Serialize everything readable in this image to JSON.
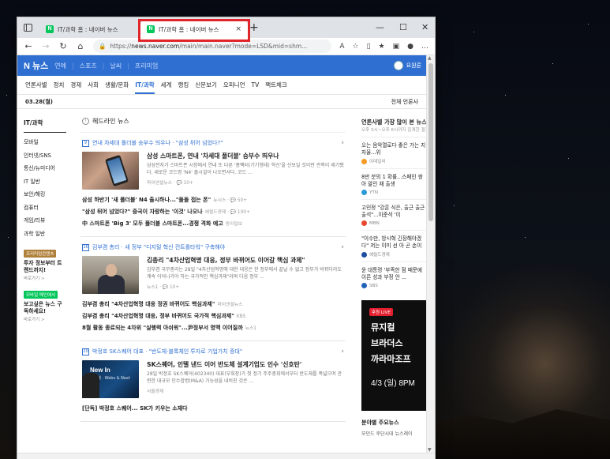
{
  "browser": {
    "tabs": [
      {
        "title": "IT/과학 홈 : 네이버 뉴스",
        "close": "×"
      },
      {
        "title": "IT/과학 홈 : 네이버 뉴스",
        "close": "×"
      }
    ],
    "new_tab": "+",
    "window_controls": [
      "—",
      "☐",
      "✕"
    ],
    "url_prefix": "https://",
    "url_host": "news.naver.com",
    "url_rest": "/main/main.naver?mode=LSD&mid=shm..."
  },
  "naver": {
    "logo_n": "N",
    "logo_text": "뉴스",
    "gnb": [
      "연예",
      "스포츠",
      "날씨",
      "프리미엄"
    ],
    "user": "요원론",
    "lnb": [
      "언론사별",
      "정치",
      "경제",
      "사회",
      "생활/문화",
      "IT/과학",
      "세계",
      "랭킹",
      "신문보기",
      "오피니언",
      "TV",
      "팩트체크"
    ],
    "active_lnb": "IT/과학",
    "date": "03.28(월)",
    "all_press": "전체 언론사"
  },
  "sidebar": {
    "title": "IT/과학",
    "items": [
      "모바일",
      "인터넷/SNS",
      "통신/뉴미디어",
      "IT 일반",
      "보안/해킹",
      "컴퓨터",
      "게임/리뷰",
      "과학 일반"
    ],
    "promo1": {
      "tag": "프리미엄콘텐츠",
      "title": "투자 정보부터 트렌드까지!",
      "sub": "바로가기 >"
    },
    "promo2": {
      "tag": "모바일 메인에서",
      "title": "보고싶은 뉴스 구독하세요!",
      "sub": "바로가기 >"
    }
  },
  "main": {
    "headline_title": "헤드라인 뉴스",
    "clusters": [
      {
        "num": "9",
        "head": "연내 차세대 폴더블 승부수 띄우나 · \"삼성 뒤어 넘었다?\"",
        "title": "삼성 스마트폰, 연내 '차세대 폴더블' 승부수 띄우나",
        "desc": "삼성전자가 스마트폰 시장에서 연내 또 다른 '폼팩터(기기형태) 혁신'을 선보일 것이란 관측이 제기됐다. 새로운 코드명 'N4' 출시설이 나오면서다. 코드 ...",
        "meta": "파이낸셜뉴스 · 💬 10+",
        "related": [
          {
            "text": "삼성 하반기 '새 폴더블' N4 출시하나...\"돌돌 접는 폰\"",
            "src": "뉴시스 · 💬 50+"
          },
          {
            "text": "\"삼성 뒤어 넘었다?\" 중국이 자랑하는 '이것' 나오나",
            "src": "헤럴드경제 · 💬 100+"
          },
          {
            "text": "中 스마트폰 'Big 3' 모두 폴더블 스마트폰...경쟁 격화 예고",
            "src": "동아일보"
          }
        ]
      },
      {
        "num": "16",
        "head": "김부겸 총리 · 새 정부 \"디지털 혁신 컨트롤타워\" 구축해야",
        "title": "김총리 \"4차산업혁명 대응, 정부 바뀌어도 이어갈 핵심 과제\"",
        "desc": "김부겸 국무총리는 28일 \"4차산업혁명에 대한 대응은 한 정부에서 끝날 수 없고 정부가 바뀌더라도 계속 이어나가야 하는 국가적인 핵심과제\"라며 다음 정부 ...",
        "meta": "뉴스1 · 💬 10+",
        "related": [
          {
            "text": "김부겸 총리 \"4차산업혁명 대응 정권 바뀌어도 핵심과제\"",
            "src": "파이낸셜뉴스"
          },
          {
            "text": "김부겸 총리 \"4차산업혁명 대응, 정부 바뀌어도 국가적 핵심과제\"",
            "src": "KBS"
          },
          {
            "text": "8월 활동 종료되는 4차위 \"실행력 아쉬워\"...尹정부서 명맥 이어질까",
            "src": "뉴스1"
          }
        ]
      },
      {
        "num": "20",
        "head": "박정호 SK스퀘어 대표 · \"반도체·블록체인 투자로 기업가치 증대\"",
        "title": "SK스퀘어, 인텔 낸드 이어 반도체 설계기업도 인수 '신호탄'",
        "desc": "28일 박정호 SK스퀘어(402340) 대표(부회장)가 첫 정기 주주총회에서부터 반도체를 폭넓으며 관련한 대규모 인수합병(M&A) 가능성을 내비친 것은 ...",
        "meta": "서울경제",
        "thumb_title": "New In",
        "thumb_sub": "반도체 · Webs\n& Next Platf",
        "related": [
          {
            "text": "[단독] 박정호 스퀘어... SK가 키우는 소재다",
            "src": ""
          }
        ]
      }
    ]
  },
  "rightpanel": {
    "title": "언론사별 가장 많이 본 뉴스",
    "sub": "오후 5시~오후 6시까지 집계한 결과입니다.",
    "items": [
      {
        "text": "오는 음악열로다 좋은 가는 지자율...위",
        "src": "이데일리",
        "color": "#f39b23"
      },
      {
        "text": "8만 분의 1 확률...스페인 쌍아 말린 채 출생",
        "src": "YTN",
        "color": "#2b9ad9"
      },
      {
        "text": "고민정 \"강훈 식은, 출근 출근 출석\"...이준석 '이",
        "src": "MBN",
        "color": "#e8492d"
      },
      {
        "text": "\"이수만, 방시혁 긴장해야겠다\" 저는 이미 선 아 곤 손이 합쳐 '이",
        "src": "헤럴드경제",
        "color": "#1c4fa0"
      },
      {
        "text": "윤 대통령 '부족한 점 때문에 이른 성과 부정 안 ...",
        "src": "SBS",
        "color": "#2063b7"
      }
    ],
    "ad": {
      "live": "후원 LIVE",
      "l1": "뮤지컬",
      "l2": "브라더스",
      "l3": "까라마조프",
      "l4": "4/3 (일) 8PM"
    },
    "bottom_title": "분야별 주요뉴스",
    "bottom_text": "모던드 후단시대 뉴스레이"
  },
  "colors": {
    "naver_blue": "#2f6fd1",
    "highlight": "#e0262b",
    "naver_green": "#03c75a"
  }
}
